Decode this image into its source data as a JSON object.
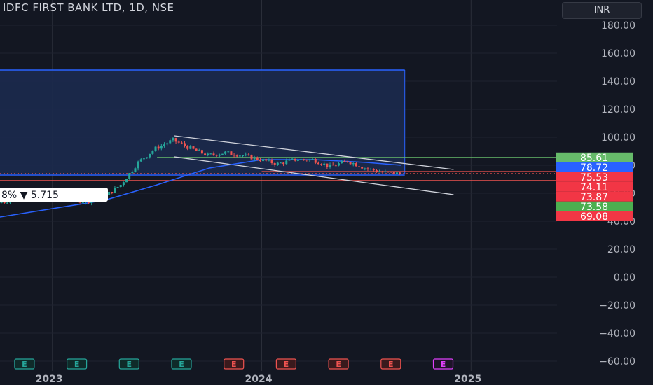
{
  "header": {
    "title": "IDFC FIRST BANK LTD, 1D, NSE",
    "currency": "INR"
  },
  "colors": {
    "background": "#131722",
    "up": "#26a69a",
    "down": "#ef5350",
    "box_fill": "#1c2a4e",
    "box_border": "#2962ff",
    "ma": "#2962ff",
    "channel": "#d1d4dc",
    "support_green": "#66bb6a"
  },
  "chart_data": {
    "type": "candlestick",
    "title": "IDFC FIRST BANK LTD, 1D, NSE",
    "ylim": [
      -60,
      190
    ],
    "y_ticks": [
      180,
      160,
      140,
      120,
      100,
      80,
      60,
      40,
      20,
      0,
      -20,
      -40,
      -60
    ],
    "x_ticks": [
      "2023",
      "2024",
      "2025"
    ],
    "grid": true,
    "close_series": [
      {
        "date": "2022-10",
        "close": 53
      },
      {
        "date": "2022-11",
        "close": 56
      },
      {
        "date": "2022-12",
        "close": 58
      },
      {
        "date": "2023-01",
        "close": 57
      },
      {
        "date": "2023-02",
        "close": 56
      },
      {
        "date": "2023-03",
        "close": 54
      },
      {
        "date": "2023-04",
        "close": 57
      },
      {
        "date": "2023-05",
        "close": 66
      },
      {
        "date": "2023-06",
        "close": 82
      },
      {
        "date": "2023-07",
        "close": 92
      },
      {
        "date": "2023-08",
        "close": 98
      },
      {
        "date": "2023-09",
        "close": 92
      },
      {
        "date": "2023-10",
        "close": 87
      },
      {
        "date": "2023-11",
        "close": 89
      },
      {
        "date": "2023-12",
        "close": 87
      },
      {
        "date": "2024-01",
        "close": 84
      },
      {
        "date": "2024-02",
        "close": 81
      },
      {
        "date": "2024-03",
        "close": 84
      },
      {
        "date": "2024-04",
        "close": 84
      },
      {
        "date": "2024-05",
        "close": 79
      },
      {
        "date": "2024-06",
        "close": 83
      },
      {
        "date": "2024-07",
        "close": 78
      },
      {
        "date": "2024-08",
        "close": 75
      },
      {
        "date": "2024-09",
        "close": 74
      }
    ],
    "moving_average": [
      {
        "date": "2022-10",
        "value": 43
      },
      {
        "date": "2023-01",
        "value": 49
      },
      {
        "date": "2023-04",
        "value": 55
      },
      {
        "date": "2023-07",
        "value": 66
      },
      {
        "date": "2023-10",
        "value": 78
      },
      {
        "date": "2024-01",
        "value": 84
      },
      {
        "date": "2024-04",
        "value": 84
      },
      {
        "date": "2024-07",
        "value": 82
      },
      {
        "date": "2024-09",
        "value": 80
      }
    ],
    "zone": {
      "top": 148,
      "bottom": 73.6,
      "from": "2022-10",
      "to": "2024-09"
    },
    "channel_upper": [
      {
        "date": "2023-08",
        "value": 101
      },
      {
        "date": "2024-12",
        "value": 77
      }
    ],
    "channel_lower": [
      {
        "date": "2023-08",
        "value": 86
      },
      {
        "date": "2024-12",
        "value": 59
      }
    ],
    "levels": [
      {
        "value": 85.61,
        "style": "green"
      },
      {
        "value": 74.11,
        "style": "red"
      },
      {
        "value": 69.08,
        "style": "red"
      }
    ],
    "price_tags": [
      {
        "label": "85.61",
        "value": 85.61,
        "color": "#66bb6a"
      },
      {
        "label": "78.72",
        "value": 78.72,
        "color": "#2962ff"
      },
      {
        "label": "75.53",
        "value": 75.53,
        "color": "#f23645"
      },
      {
        "label": "74.11",
        "value": 74.11,
        "color": "#f23645"
      },
      {
        "label": "73.87",
        "value": 73.87,
        "color": "#f23645"
      },
      {
        "label": "73.58",
        "value": 73.58,
        "color": "#4caf50"
      },
      {
        "label": "69.08",
        "value": 69.08,
        "color": "#f23645"
      }
    ],
    "annotation": {
      "text": "8% ▼ 5.715",
      "date": "2022-12",
      "value": 60
    },
    "earnings": [
      {
        "label": "E",
        "date": "2022-11",
        "type": "past-up"
      },
      {
        "label": "E",
        "date": "2023-02",
        "type": "past-up"
      },
      {
        "label": "E",
        "date": "2023-05",
        "type": "past-up"
      },
      {
        "label": "E",
        "date": "2023-08",
        "type": "past-up"
      },
      {
        "label": "E",
        "date": "2023-11",
        "type": "past-down"
      },
      {
        "label": "E",
        "date": "2024-02",
        "type": "past-down"
      },
      {
        "label": "E",
        "date": "2024-05",
        "type": "past-down"
      },
      {
        "label": "E",
        "date": "2024-08",
        "type": "past-down"
      },
      {
        "label": "E",
        "date": "2024-11",
        "type": "future"
      }
    ]
  }
}
